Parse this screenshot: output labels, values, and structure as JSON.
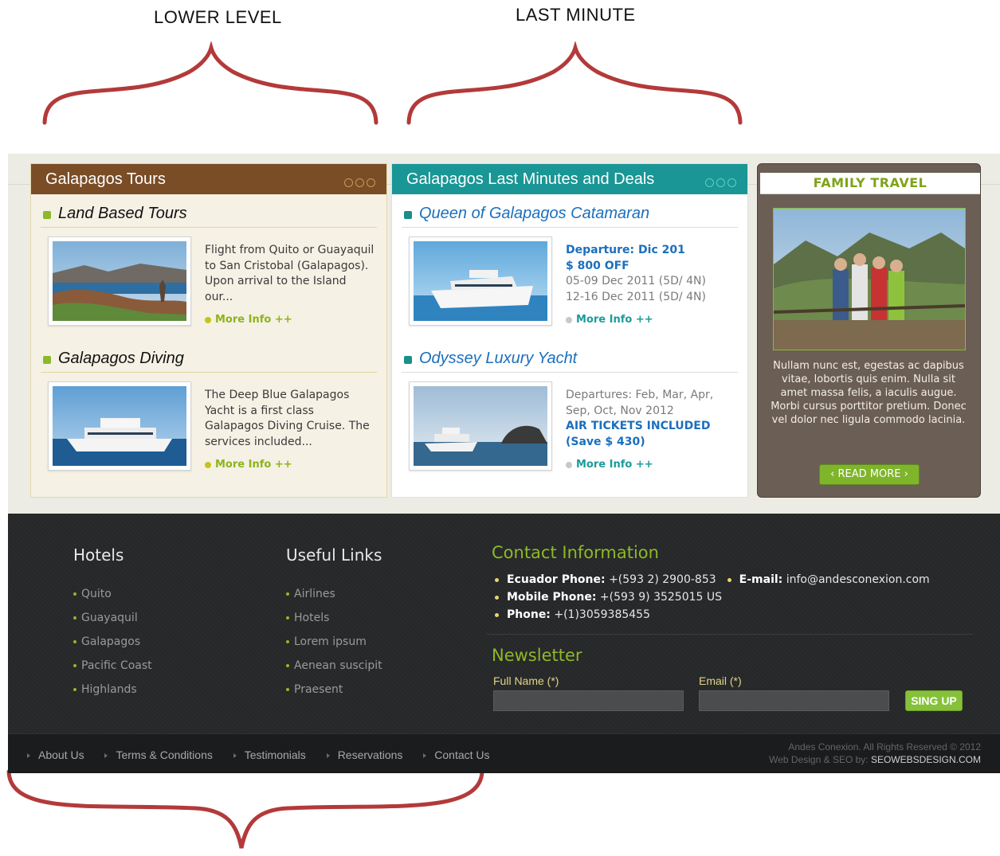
{
  "annotations": {
    "left": "LOWER LEVEL",
    "right": "LAST MINUTE"
  },
  "tours": {
    "title": "Galapagos Tours",
    "items": [
      {
        "name": "Land Based Tours",
        "desc": "Flight from Quito or Guayaquil to San Cristobal (Galapagos). Upon arrival to the Island our...",
        "more": "More Info ++"
      },
      {
        "name": "Galapagos Diving",
        "desc": "The Deep Blue Galapagos Yacht is a first class Galapagos Diving Cruise. The services included...",
        "more": "More Info ++"
      }
    ]
  },
  "deals": {
    "title": "Galapagos Last Minutes and Deals",
    "items": [
      {
        "name": "Queen of Galapagos Catamaran",
        "line1": "Departure: Dic 201",
        "line2": "$ 800 OFF",
        "line3": "05-09 Dec 2011 (5D/ 4N)",
        "line4": "12-16 Dec 2011 (5D/ 4N)",
        "more": "More Info ++"
      },
      {
        "name": "Odyssey Luxury Yacht",
        "line1": "Departures: Feb, Mar, Apr, Sep, Oct, Nov 2012",
        "line2": "AIR TICKETS INCLUDED",
        "line3": "(Save $ 430)",
        "more": "More Info ++"
      }
    ]
  },
  "family": {
    "title": "FAMILY TRAVEL",
    "text": "Nullam nunc est, egestas ac dapibus vitae, lobortis quis enim. Nulla sit amet massa felis, a iaculis augue. Morbi cursus porttitor pretium. Donec vel dolor nec ligula commodo lacinia.",
    "button": "‹ READ MORE ›"
  },
  "footer": {
    "hotels": {
      "title": "Hotels",
      "items": [
        "Quito",
        "Guayaquil",
        "Galapagos",
        "Pacific Coast",
        "Highlands"
      ]
    },
    "links": {
      "title": "Useful Links",
      "items": [
        "Airlines",
        "Hotels",
        "Lorem ipsum",
        "Aenean suscipit",
        "Praesent"
      ]
    },
    "contact": {
      "title": "Contact Information",
      "ecuador_label": "Ecuador Phone:",
      "ecuador_value": "+(593 2) 2900-853",
      "email_label": "E-mail:",
      "email_value": "info@andesconexion.com",
      "mobile_label": "Mobile Phone:",
      "mobile_value": "+(593 9) 3525015 US",
      "phone_label": "Phone:",
      "phone_value": "+(1)3059385455"
    },
    "newsletter": {
      "title": "Newsletter",
      "name_label": "Full Name (*)",
      "email_label": "Email (*)",
      "button": "SING UP"
    },
    "nav": [
      "About Us",
      "Terms & Conditions",
      "Testimonials",
      "Reservations",
      "Contact Us"
    ],
    "copyright": "Andes Conexion. All Rights Reserved © 2012",
    "credit_prefix": "Web Design & SEO by:",
    "credit_name": "SEOWEBSDESIGN.COM"
  },
  "colors": {
    "brand_brown": "#7a4d26",
    "brand_teal": "#199695",
    "accent_green": "#8db928",
    "link_blue": "#1b6fbd"
  }
}
